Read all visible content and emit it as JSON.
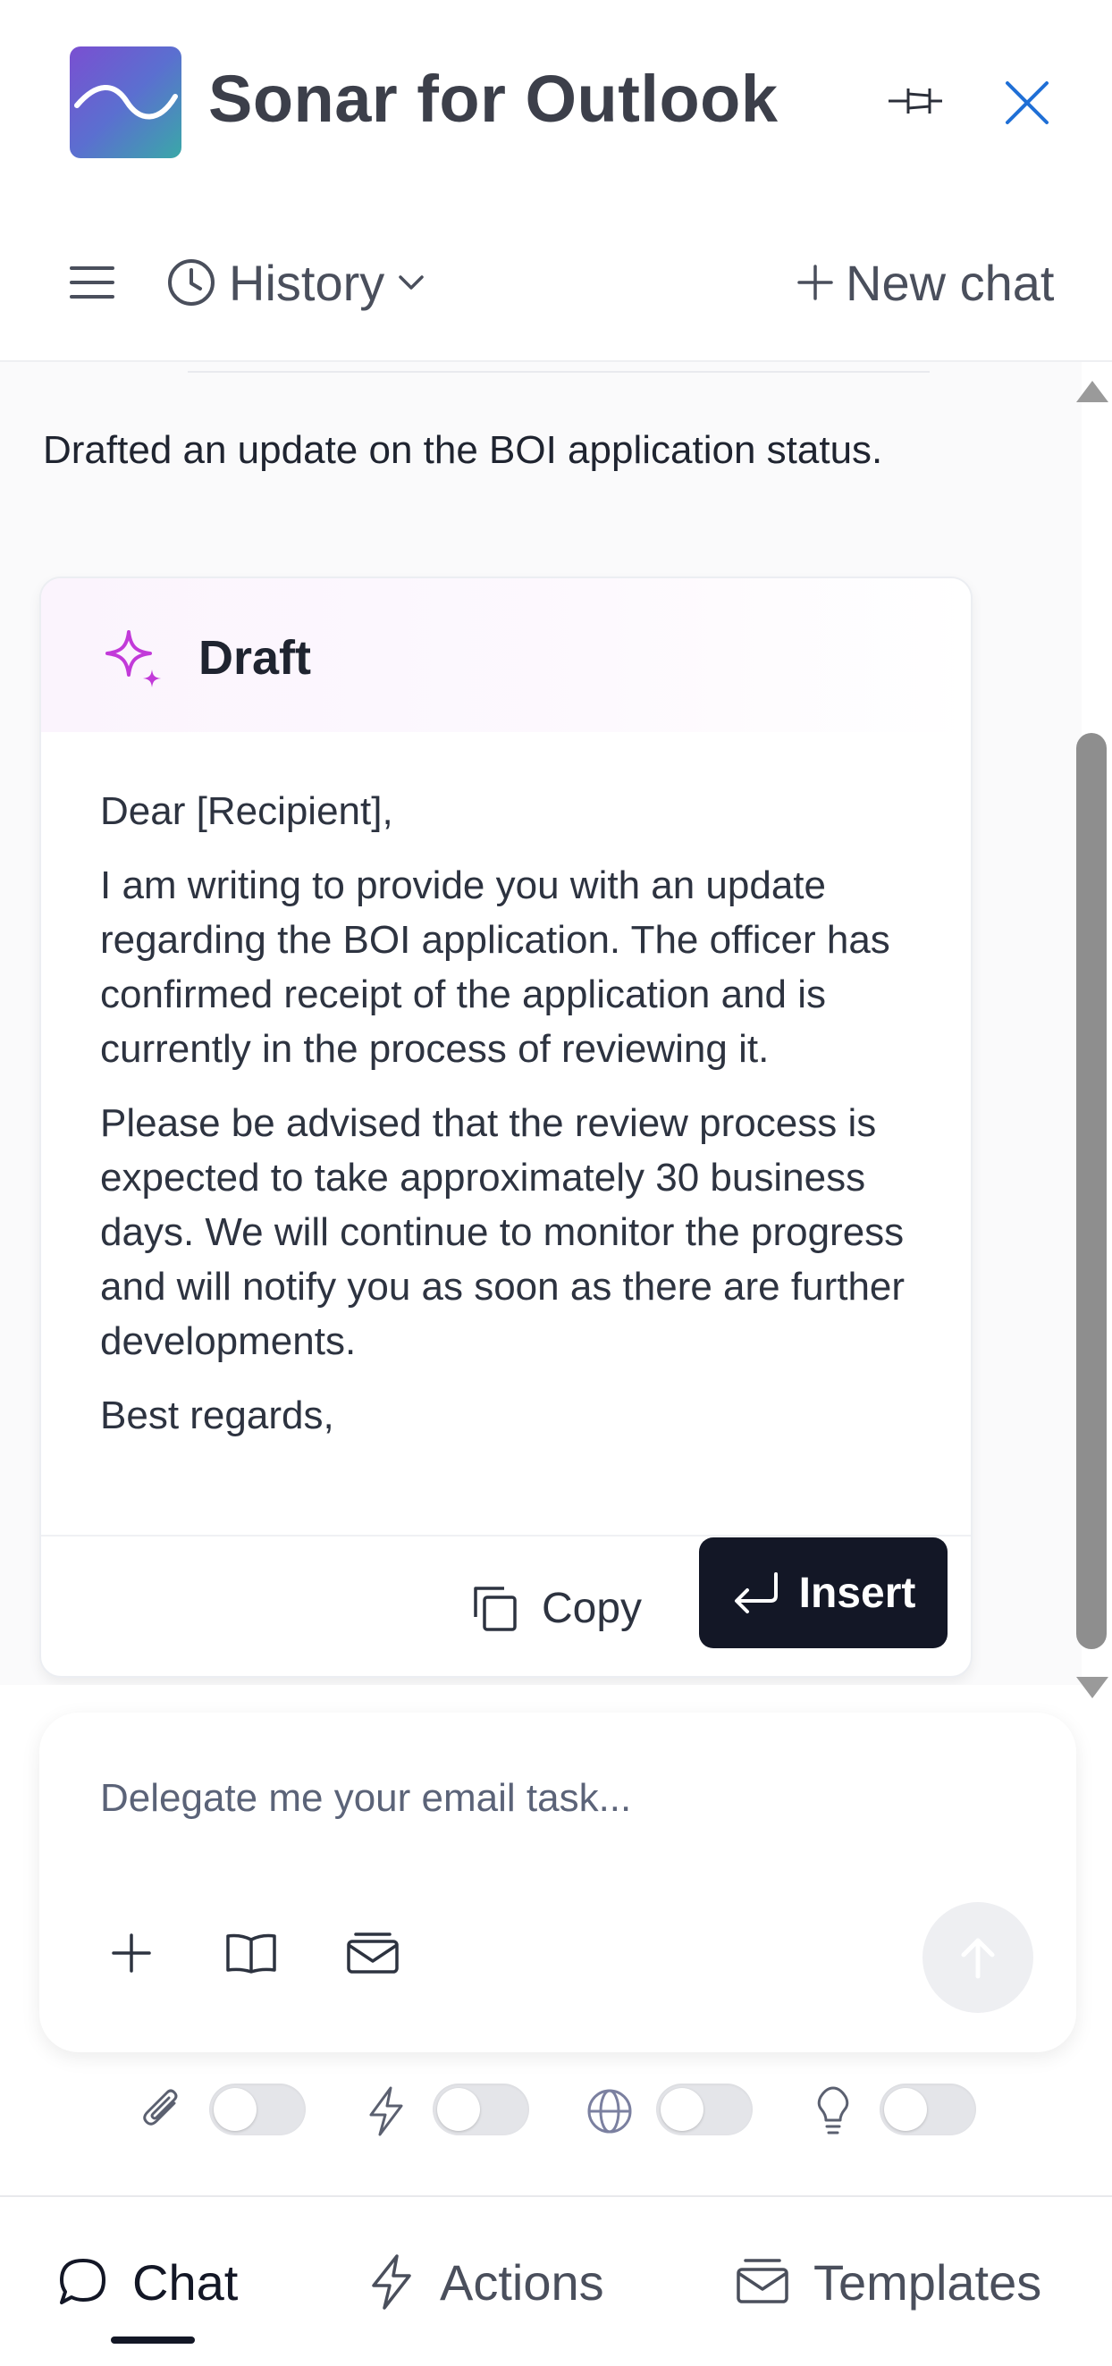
{
  "header": {
    "app_title": "Sonar for Outlook"
  },
  "toolbar": {
    "history_label": "History",
    "new_chat_label": "New chat"
  },
  "chat": {
    "assistant_message": "Drafted an update on the BOI application status.",
    "draft": {
      "title": "Draft",
      "paragraphs": [
        "Dear [Recipient],",
        "I am writing to provide you with an update regarding the BOI application. The officer has confirmed receipt of the application and is currently in the process of reviewing it.",
        "Please be advised that the review process is expected to take approximately 30 business days. We will continue to monitor the progress and will notify you as soon as there are further developments.",
        "Best regards,"
      ],
      "copy_label": "Copy",
      "insert_label": "Insert"
    }
  },
  "composer": {
    "placeholder": "Delegate me your email task...",
    "value": ""
  },
  "toggles": [
    {
      "icon": "paperclip-icon",
      "on": false
    },
    {
      "icon": "lightning-icon",
      "on": false
    },
    {
      "icon": "globe-icon",
      "on": false
    },
    {
      "icon": "lightbulb-icon",
      "on": false
    }
  ],
  "bottom_nav": {
    "items": [
      {
        "label": "Chat",
        "icon": "chat-bubble-icon",
        "active": true
      },
      {
        "label": "Actions",
        "icon": "lightning-icon",
        "active": false
      },
      {
        "label": "Templates",
        "icon": "templates-icon",
        "active": false
      }
    ]
  },
  "colors": {
    "primary_dark": "#131726",
    "accent_blue": "#1f6fd6",
    "spark_magenta": "#c23ad9"
  }
}
